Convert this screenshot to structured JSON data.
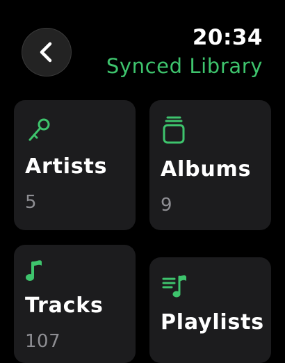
{
  "status": {
    "time": "20:34"
  },
  "header": {
    "title": "Synced Library",
    "back_icon": "chevron-left-icon"
  },
  "accent_color": "#3ec46d",
  "categories": [
    {
      "label": "Artists",
      "count": "5",
      "icon": "microphone-icon"
    },
    {
      "label": "Albums",
      "count": "9",
      "icon": "album-stack-icon"
    },
    {
      "label": "Tracks",
      "count": "107",
      "icon": "music-note-icon"
    },
    {
      "label": "Playlists",
      "count": "",
      "icon": "playlist-icon"
    }
  ]
}
